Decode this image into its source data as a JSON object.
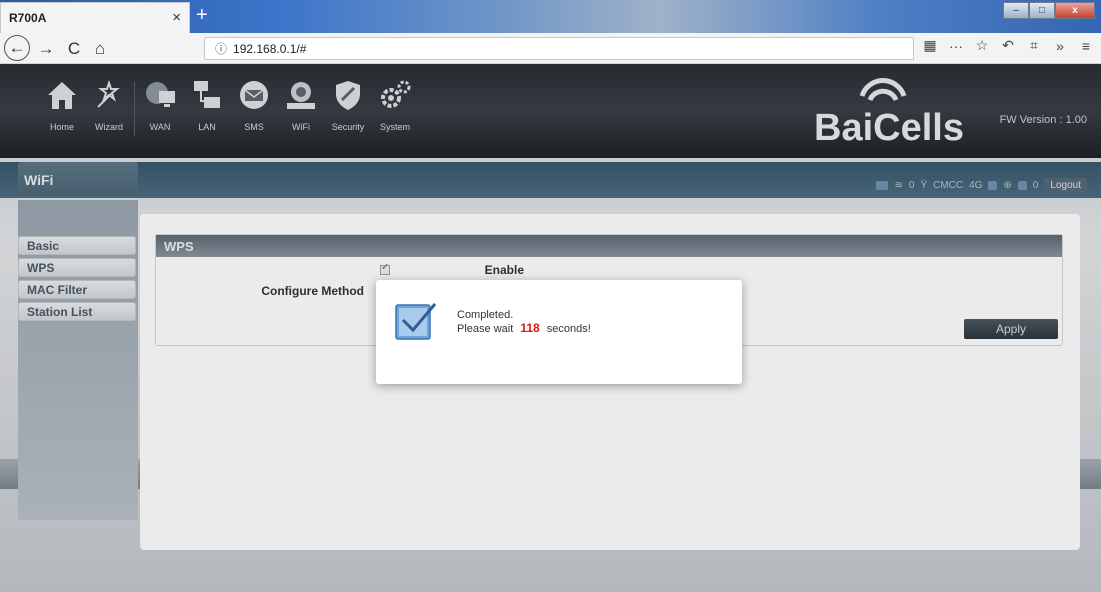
{
  "browser": {
    "tab_title": "R700A",
    "tab_close": "×",
    "new_tab": "+",
    "url": "192.168.0.1/#"
  },
  "header": {
    "nav": [
      {
        "label": "Home",
        "icon": "home-icon"
      },
      {
        "label": "Wizard",
        "icon": "wizard-icon"
      },
      {
        "label": "WAN",
        "icon": "wan-icon"
      },
      {
        "label": "LAN",
        "icon": "lan-icon"
      },
      {
        "label": "SMS",
        "icon": "sms-icon"
      },
      {
        "label": "WiFi",
        "icon": "wifi-icon"
      },
      {
        "label": "Security",
        "icon": "security-icon"
      },
      {
        "label": "System",
        "icon": "system-icon"
      }
    ],
    "logo_text": "BaiCells",
    "fw_version": "FW Version : 1.00"
  },
  "section": {
    "title": "WiFi",
    "status": {
      "signal_count": "0",
      "carrier": "CMCC",
      "network": "4G",
      "msg_count": "0",
      "logout": "Logout"
    }
  },
  "sidebar": {
    "items": [
      {
        "label": "Basic"
      },
      {
        "label": "WPS"
      },
      {
        "label": "MAC Filter"
      },
      {
        "label": "Station List"
      }
    ]
  },
  "wps": {
    "title": "WPS",
    "enable_label": "Enable",
    "enable_checked": true,
    "configure_method_label": "Configure Method",
    "apply_label": "Apply"
  },
  "modal": {
    "line1": "Completed.",
    "line2_prefix": "Please wait",
    "seconds": "118",
    "line2_suffix": "seconds!"
  },
  "colors": {
    "accent_red": "#d21919",
    "header_dark": "#2b2f35"
  }
}
